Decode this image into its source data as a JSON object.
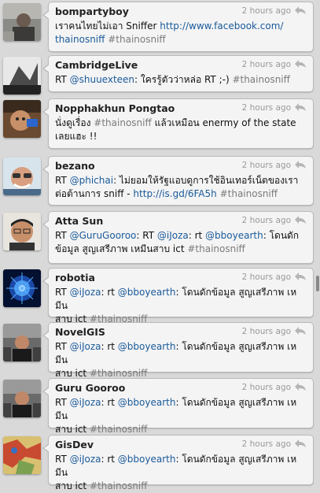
{
  "tweets": [
    {
      "user": "bompartyboy",
      "time": "2 hours ago",
      "segments": [
        {
          "t": "text",
          "v": "เราคนไทยไม่เอา Sniffer "
        },
        {
          "t": "link",
          "v": "http://www.facebook.com/\nthainosniff"
        },
        {
          "t": "text",
          "v": " "
        },
        {
          "t": "tag",
          "v": "#thainosniff"
        }
      ]
    },
    {
      "user": "CambridgeLive",
      "time": "2 hours ago",
      "segments": [
        {
          "t": "text",
          "v": "RT "
        },
        {
          "t": "link",
          "v": "@shuuexteen"
        },
        {
          "t": "text",
          "v": ": ใครรู้ตัวว่าหล่อ RT ;-) "
        },
        {
          "t": "tag",
          "v": "#thainosniff"
        }
      ]
    },
    {
      "user": "Nopphakhun Pongtao",
      "time": "2 hours ago",
      "segments": [
        {
          "t": "text",
          "v": "นั่งดูเรื่อง "
        },
        {
          "t": "tag",
          "v": "#thainosniff"
        },
        {
          "t": "text",
          "v": " แล้วเหมือน enermy of the state\nเลยแฮะ !!"
        }
      ]
    },
    {
      "user": "bezano",
      "time": "2 hours ago",
      "segments": [
        {
          "t": "text",
          "v": "RT "
        },
        {
          "t": "link",
          "v": "@phichai"
        },
        {
          "t": "text",
          "v": ": ไม่ยอมให้รัฐแอบดูการใช้อินเทอร์เน็ตของเรา\nต่อต้านการ sniff - "
        },
        {
          "t": "link",
          "v": "http://is.gd/6FA5h"
        },
        {
          "t": "text",
          "v": " "
        },
        {
          "t": "tag",
          "v": "#thainosniff"
        }
      ]
    },
    {
      "user": "Atta Sun",
      "time": "2 hours ago",
      "segments": [
        {
          "t": "text",
          "v": "RT "
        },
        {
          "t": "link",
          "v": "@GuruGooroo"
        },
        {
          "t": "text",
          "v": ": RT "
        },
        {
          "t": "link",
          "v": "@iJoza"
        },
        {
          "t": "text",
          "v": ": rt "
        },
        {
          "t": "link",
          "v": "@bboyearth"
        },
        {
          "t": "text",
          "v": ": โดนดัก\nข้อมูล สูญเสรีภาพ เหมีนสาบ ict "
        },
        {
          "t": "tag",
          "v": "#thainosniff"
        }
      ]
    },
    {
      "user": "robotia",
      "time": "2 hours ago",
      "segments": [
        {
          "t": "text",
          "v": "RT "
        },
        {
          "t": "link",
          "v": "@iJoza"
        },
        {
          "t": "text",
          "v": ": rt "
        },
        {
          "t": "link",
          "v": "@bboyearth"
        },
        {
          "t": "text",
          "v": ": โดนดักข้อมูล สูญเสรีภาพ เหมีน\nสาบ ict "
        },
        {
          "t": "tag",
          "v": "#thainosniff"
        }
      ]
    },
    {
      "user": "NovelGIS",
      "time": "2 hours ago",
      "segments": [
        {
          "t": "text",
          "v": "RT "
        },
        {
          "t": "link",
          "v": "@iJoza"
        },
        {
          "t": "text",
          "v": ": rt "
        },
        {
          "t": "link",
          "v": "@bboyearth"
        },
        {
          "t": "text",
          "v": ": โดนดักข้อมูล สูญเสรีภาพ เหมีน\nสาบ ict "
        },
        {
          "t": "tag",
          "v": "#thainosniff"
        }
      ]
    },
    {
      "user": "Guru Gooroo",
      "time": "2 hours ago",
      "segments": [
        {
          "t": "text",
          "v": "RT "
        },
        {
          "t": "link",
          "v": "@iJoza"
        },
        {
          "t": "text",
          "v": ": rt "
        },
        {
          "t": "link",
          "v": "@bboyearth"
        },
        {
          "t": "text",
          "v": ": โดนดักข้อมูล สูญเสรีภาพ เหมีน\nสาบ ict "
        },
        {
          "t": "tag",
          "v": "#thainosniff"
        }
      ]
    },
    {
      "user": "GisDev",
      "time": "2 hours ago",
      "segments": [
        {
          "t": "text",
          "v": "RT "
        },
        {
          "t": "link",
          "v": "@iJoza"
        },
        {
          "t": "text",
          "v": ": rt "
        },
        {
          "t": "link",
          "v": "@bboyearth"
        },
        {
          "t": "text",
          "v": ": โดนดักข้อมูล สูญเสรีภาพ เหมีน\nสาบ ict "
        },
        {
          "t": "tag",
          "v": "#thainosniff"
        }
      ]
    }
  ],
  "colors": {
    "link": "#1a5a9a",
    "hashtag": "#7a7a7a",
    "bubble": "#f4f4f4",
    "background": "#d9d9d9"
  },
  "icons": {
    "reply": "reply-arrow-icon"
  }
}
